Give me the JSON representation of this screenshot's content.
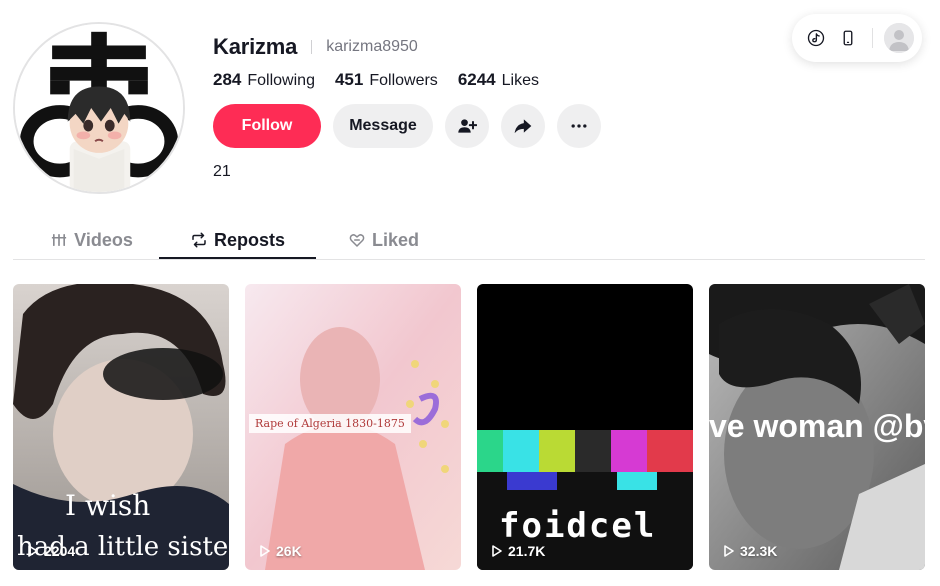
{
  "profile": {
    "display_name": "Karizma",
    "username": "karizma8950",
    "bio": "21"
  },
  "stats": [
    {
      "value": "284",
      "label": "Following"
    },
    {
      "value": "451",
      "label": "Followers"
    },
    {
      "value": "6244",
      "label": "Likes"
    }
  ],
  "actions": {
    "follow_label": "Follow",
    "message_label": "Message"
  },
  "icons": {
    "add_friend": "add-user-icon",
    "share": "share-icon",
    "more": "more-icon",
    "tiktok": "tiktok-icon",
    "phone": "phone-icon",
    "user_avatar": "avatar-icon"
  },
  "tabs": [
    {
      "label": "Videos",
      "icon": "grid-icon",
      "active": false
    },
    {
      "label": "Reposts",
      "icon": "repost-icon",
      "active": true
    },
    {
      "label": "Liked",
      "icon": "heart-icon",
      "active": false
    }
  ],
  "videos": [
    {
      "views": "2204",
      "overlay": [
        "I wish",
        "had a little sister"
      ]
    },
    {
      "views": "26K",
      "overlay": [
        "Rape of Algeria 1830-1875"
      ]
    },
    {
      "views": "21.7K",
      "overlay": [
        "foidcel"
      ]
    },
    {
      "views": "32.3K",
      "overlay": [
        "ve woman @bv"
      ]
    }
  ],
  "colors": {
    "accent": "#fe2c55",
    "text": "#161823",
    "muted": "#757680",
    "button_bg": "#efeff0"
  }
}
